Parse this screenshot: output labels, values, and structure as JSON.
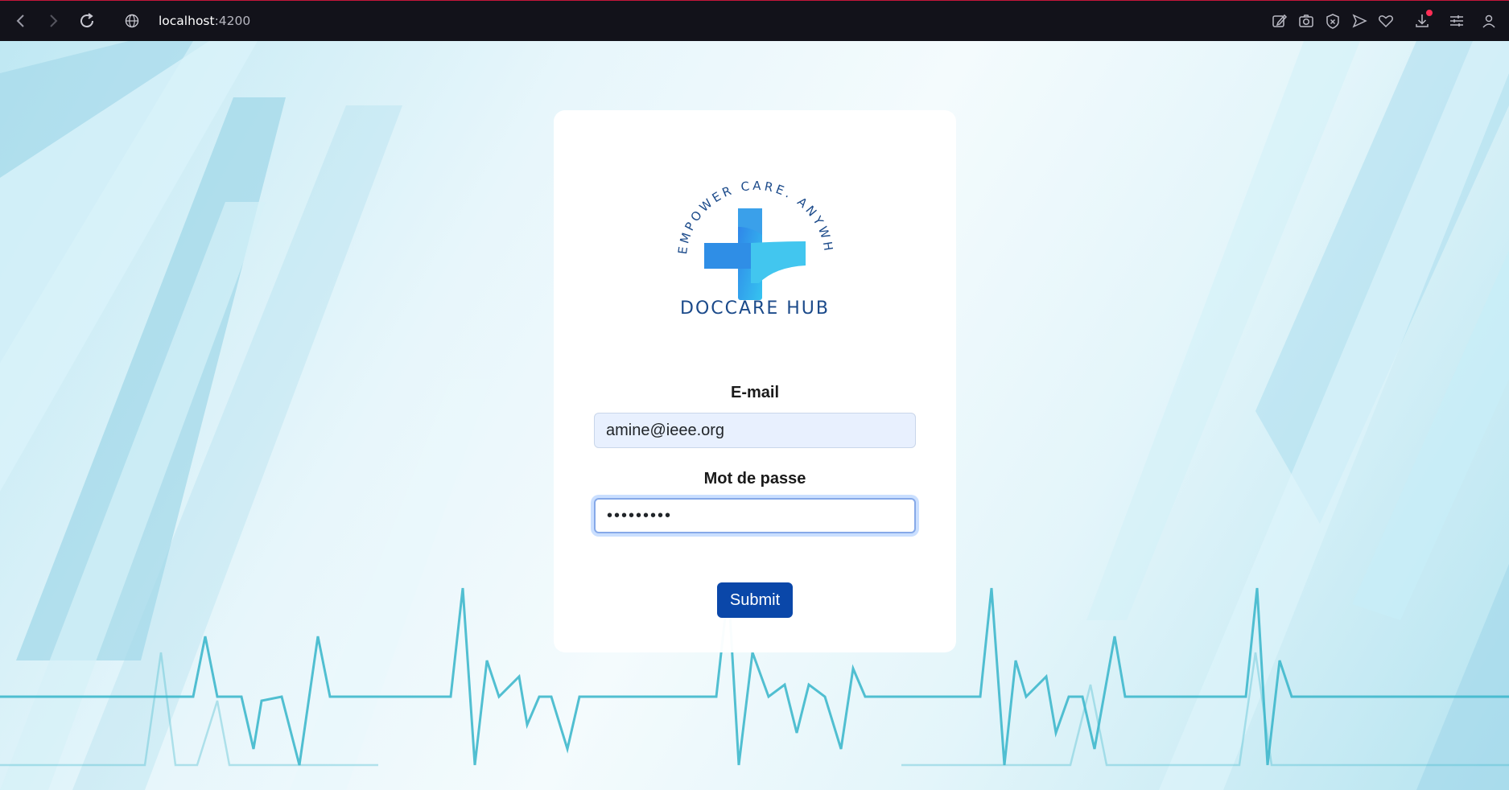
{
  "browser": {
    "url_host": "localhost",
    "url_port": ":4200"
  },
  "brand": {
    "tagline": "EMPOWER CARE. ANYWHERE",
    "name": "DOCCARE HUB"
  },
  "form": {
    "email_label": "E-mail",
    "email_value": "amine@ieee.org",
    "password_label": "Mot de passe",
    "password_value": "•••••••••",
    "submit_label": "Submit"
  },
  "colors": {
    "accent": "#0a47a9",
    "brand_text": "#1b4a8a",
    "heartbeat": "#3fb8cc"
  },
  "icons": [
    "back-icon",
    "forward-icon",
    "reload-icon",
    "globe-icon",
    "edit-icon",
    "camera-icon",
    "close-circle-icon",
    "send-icon",
    "heart-icon",
    "download-icon",
    "settings-icon",
    "profile-icon"
  ]
}
